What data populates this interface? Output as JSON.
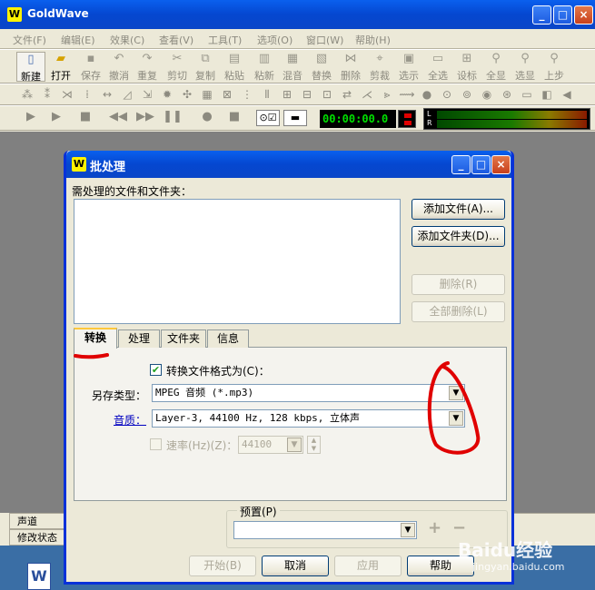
{
  "app": {
    "title": "GoldWave",
    "logo": "W"
  },
  "menu": [
    "文件(F)",
    "编辑(E)",
    "效果(C)",
    "查看(V)",
    "工具(T)",
    "选项(O)",
    "窗口(W)",
    "帮助(H)"
  ],
  "toolbar": [
    "新建",
    "打开",
    "保存",
    "撤消",
    "重复",
    "剪切",
    "复制",
    "粘贴",
    "粘新",
    "混音",
    "替换",
    "删除",
    "剪裁",
    "选示",
    "全选",
    "设标",
    "全显",
    "选显",
    "上步"
  ],
  "time_display": "00:00:00.0",
  "meter": {
    "l": "L",
    "r": "R"
  },
  "status": {
    "channel": "声道",
    "modified": "修改状态"
  },
  "dialog": {
    "title": "批处理",
    "files_label": "需处理的文件和文件夹：",
    "add_file": "添加文件(A)...",
    "add_folder": "添加文件夹(D)...",
    "delete": "删除(R)",
    "delete_all": "全部删除(L)",
    "tabs": [
      "转换",
      "处理",
      "文件夹",
      "信息"
    ],
    "convert_checkbox": "转换文件格式为(C)：",
    "save_type_label": "另存类型：",
    "save_type_value": "MPEG 音频 (*.mp3)",
    "quality_label": "音质：",
    "quality_value": "Layer-3, 44100 Hz, 128 kbps, 立体声",
    "rate_label": "速率(Hz)(Z)：",
    "rate_value": "44100",
    "preset_label": "预置(P)",
    "preset_add": "+",
    "preset_remove": "−",
    "start": "开始(B)",
    "cancel": "取消",
    "apply": "应用",
    "help": "帮助"
  },
  "watermark": {
    "text": "Baidu经验",
    "url": "jingyan.baidu.com"
  }
}
